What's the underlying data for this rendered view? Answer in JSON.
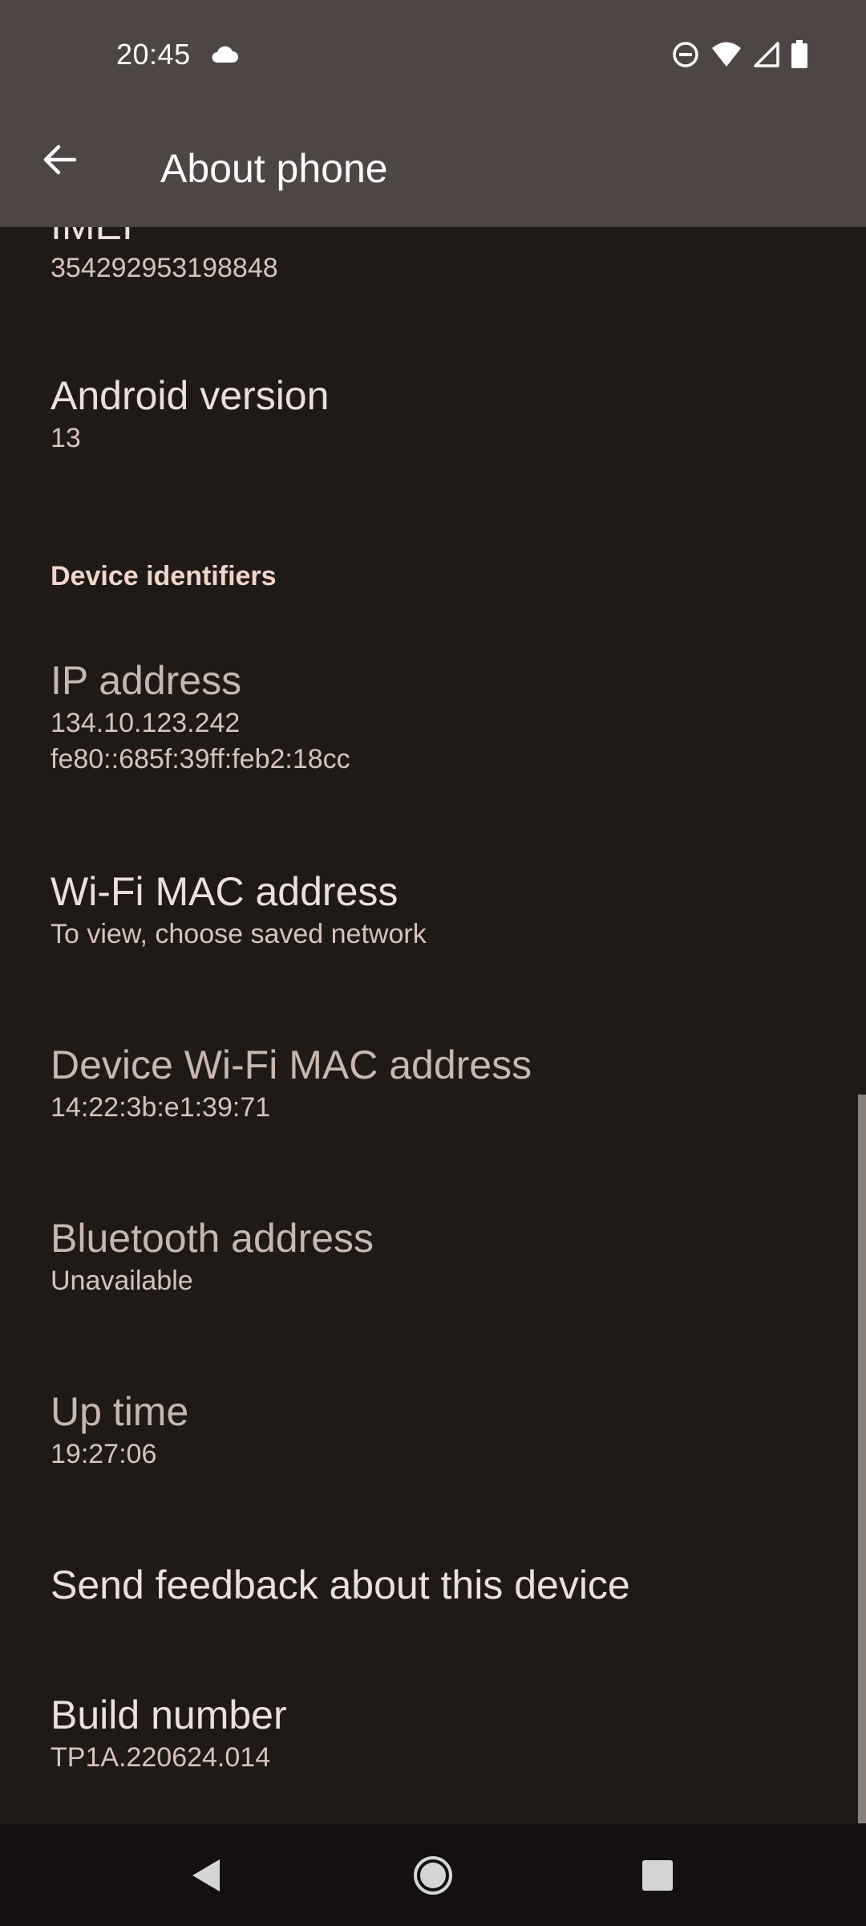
{
  "status_bar": {
    "time": "20:45",
    "icons": [
      "cloud-icon",
      "do-not-disturb-icon",
      "wifi-icon",
      "signal-icon",
      "battery-icon"
    ]
  },
  "app_bar": {
    "title": "About phone",
    "back_icon": "arrow-back-icon"
  },
  "items": {
    "imei": {
      "title": "IMEI",
      "summary": "354292953198848"
    },
    "android_version": {
      "title": "Android version",
      "summary": "13"
    },
    "section_header": "Device identifiers",
    "ip_address": {
      "title": "IP address",
      "summary_line1": "134.10.123.242",
      "summary_line2": "fe80::685f:39ff:feb2:18cc"
    },
    "wifi_mac": {
      "title": "Wi-Fi MAC address",
      "summary": "To view, choose saved network"
    },
    "device_wifi_mac": {
      "title": "Device Wi-Fi MAC address",
      "summary": "14:22:3b:e1:39:71"
    },
    "bluetooth": {
      "title": "Bluetooth address",
      "summary": "Unavailable"
    },
    "uptime": {
      "title": "Up time",
      "summary": "19:27:06"
    },
    "feedback": {
      "title": "Send feedback about this device"
    },
    "build_number": {
      "title": "Build number",
      "summary": "TP1A.220624.014"
    }
  },
  "nav_bar": {
    "back": "nav-back-icon",
    "home": "nav-home-icon",
    "recents": "nav-recents-icon"
  },
  "colors": {
    "background": "#201a17",
    "app_bar": "#4d4644",
    "section_header": "#f0d6c9"
  }
}
